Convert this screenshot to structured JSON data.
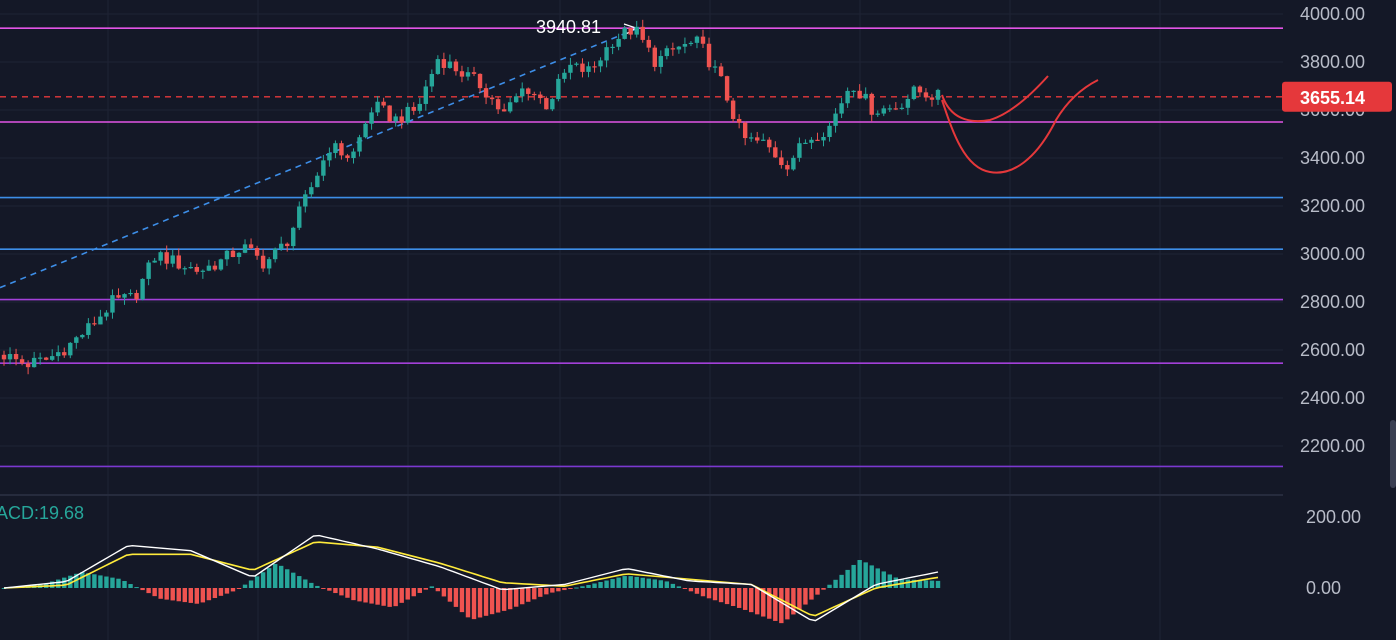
{
  "chart_data": [
    {
      "type": "candlestick",
      "ylim": [
        2050,
        4080
      ],
      "y_ticks": [
        "4000.00",
        "3800.00",
        "3600.00",
        "3400.00",
        "3200.00",
        "3000.00",
        "2800.00",
        "2600.00",
        "2400.00",
        "2200.00"
      ],
      "y_tick_values": [
        4000,
        3800,
        3600,
        3400,
        3200,
        3000,
        2800,
        2600,
        2400,
        2200
      ],
      "last_price": {
        "label": "3655.14",
        "value": 3655.14,
        "color": "#e5383b"
      },
      "peak_annotation": {
        "label": "3940.81",
        "value": 3940.81
      },
      "horizontal_levels": [
        {
          "value": 3940.81,
          "color": "#e254e6"
        },
        {
          "value": 3550,
          "color": "#e254e6"
        },
        {
          "value": 3235,
          "color": "#3d8ee8"
        },
        {
          "value": 3020,
          "color": "#3d8ee8"
        },
        {
          "value": 2810,
          "color": "#a340d9"
        },
        {
          "value": 2545,
          "color": "#a340d9"
        },
        {
          "value": 2115,
          "color": "#7b38d0"
        }
      ],
      "trendline": {
        "from": 2860,
        "to": 3940.81,
        "color": "#3d8ee8"
      },
      "price_path_keypoints": [
        2580,
        2540,
        2560,
        2620,
        2700,
        2800,
        2820,
        3000,
        2960,
        2930,
        2970,
        3030,
        2960,
        3050,
        3250,
        3450,
        3400,
        3620,
        3560,
        3600,
        3820,
        3760,
        3700,
        3580,
        3700,
        3620,
        3780,
        3760,
        3890,
        3940,
        3800,
        3860,
        3880,
        3720,
        3480,
        3460,
        3370,
        3480,
        3530,
        3720,
        3600,
        3610,
        3680,
        3655
      ],
      "candle_count": 156,
      "colors": {
        "up": "#26a69a",
        "down": "#ef5350"
      }
    },
    {
      "type": "macd",
      "label": "ACD:19.68",
      "y_ticks": [
        "200.00",
        "0.00"
      ],
      "y_tick_values": [
        200,
        0
      ],
      "ylim": [
        -130,
        230
      ],
      "histogram_keypoints": [
        0,
        10,
        45,
        25,
        -30,
        -45,
        -5,
        70,
        8,
        -35,
        -55,
        5,
        -90,
        -60,
        -15,
        8,
        35,
        20,
        -25,
        -60,
        -100,
        -10,
        80,
        25,
        20
      ],
      "macd_keypoints": [
        0,
        18,
        120,
        105,
        30,
        150,
        110,
        60,
        -5,
        10,
        55,
        20,
        10,
        -95,
        10,
        45
      ],
      "signal_keypoints": [
        0,
        8,
        95,
        95,
        50,
        130,
        115,
        70,
        15,
        5,
        40,
        25,
        10,
        -80,
        0,
        30
      ],
      "colors": {
        "hist_up": "#26a69a",
        "hist_down": "#ef5350",
        "macd": "#ffffff",
        "signal": "#ffeb3b"
      }
    }
  ],
  "drawings": {
    "color": "#e5383b",
    "curve_upper": "shallow U projection",
    "curve_lower": "deep U projection"
  }
}
